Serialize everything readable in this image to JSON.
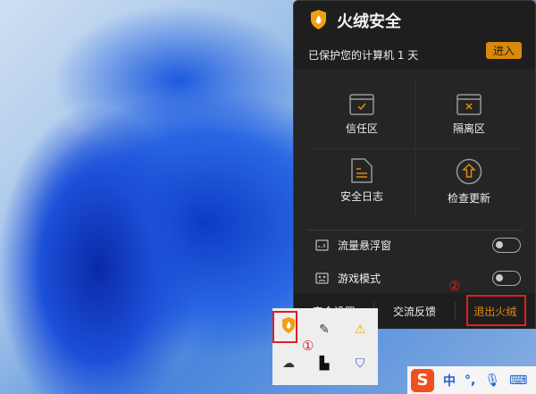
{
  "app": {
    "title": "火绒安全",
    "protected_text": "已保护您的计算机 1 天",
    "enter_label": "进入"
  },
  "tiles": [
    {
      "label": "信任区",
      "icon": "trust-zone-icon"
    },
    {
      "label": "隔离区",
      "icon": "quarantine-icon"
    },
    {
      "label": "安全日志",
      "icon": "log-icon"
    },
    {
      "label": "检查更新",
      "icon": "update-icon"
    }
  ],
  "toggles": [
    {
      "label": "流量悬浮窗",
      "on": false
    },
    {
      "label": "游戏模式",
      "on": false
    }
  ],
  "footer": {
    "settings": "安全设置",
    "feedback": "交流反馈",
    "exit": "退出火绒"
  },
  "annotations": {
    "one": "①",
    "two": "②"
  },
  "taskbar": {
    "ime_lang": "中",
    "ime_punct": "°,"
  },
  "colors": {
    "accent": "#e08a10",
    "annotation": "#e02020"
  }
}
